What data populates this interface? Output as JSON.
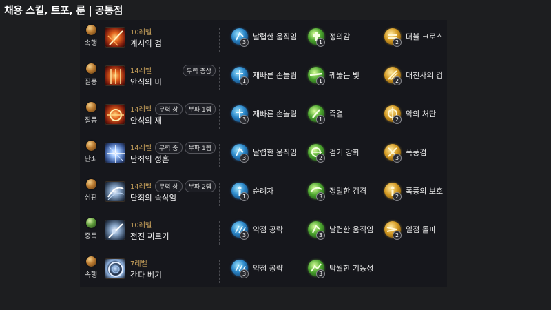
{
  "page_title": "채용 스킬, 트포, 룬 | 공통점",
  "colors": {
    "background": "#1d1e20",
    "panel": "#16171c",
    "level_text": "#c9a25b",
    "tripod_blue": "#2a86c8",
    "tripod_green": "#4ba52e",
    "tripod_gold": "#d49a22"
  },
  "rows": [
    {
      "rune": {
        "name": "속행",
        "icon": "rune-gem-icon"
      },
      "skill": {
        "level": "10레벨",
        "name": "계시의 검",
        "icon": "sword-revelation-icon"
      },
      "tags": [],
      "tripods": [
        {
          "name": "날렵한 움직임",
          "level": "3",
          "icon": "agile-movement-icon"
        },
        {
          "name": "정의감",
          "level": "1",
          "icon": "justice-icon"
        },
        {
          "name": "더블 크로스",
          "level": "2",
          "icon": "double-cross-icon"
        }
      ]
    },
    {
      "rune": {
        "name": "질풍",
        "icon": "rune-gem-icon"
      },
      "skill": {
        "level": "14레벨",
        "name": "안식의 비",
        "icon": "rain-of-rest-icon"
      },
      "tags": [
        "무력 증상"
      ],
      "tripods": [
        {
          "name": "재빠른 손놀림",
          "level": "1",
          "icon": "quick-hands-icon"
        },
        {
          "name": "꿰뚫는 빛",
          "level": "1",
          "icon": "piercing-light-icon"
        },
        {
          "name": "대천사의 검",
          "level": "2",
          "icon": "archangel-sword-icon"
        }
      ]
    },
    {
      "rune": {
        "name": "질풍",
        "icon": "rune-gem-icon"
      },
      "skill": {
        "level": "14레벨",
        "name": "안식의 재",
        "icon": "ash-of-rest-icon"
      },
      "tags": [
        "무력 상",
        "부파 1렙"
      ],
      "tripods": [
        {
          "name": "재빠른 손놀림",
          "level": "3",
          "icon": "quick-hands-icon"
        },
        {
          "name": "즉결",
          "level": "1",
          "icon": "summary-judgment-icon"
        },
        {
          "name": "악의 처단",
          "level": "2",
          "icon": "evil-punishment-icon"
        }
      ]
    },
    {
      "rune": {
        "name": "단죄",
        "icon": "rune-gem-icon"
      },
      "skill": {
        "level": "14레벨",
        "name": "단죄의 성흔",
        "icon": "stigma-of-judgment-icon"
      },
      "tags": [
        "무력 중",
        "부파 1렙"
      ],
      "tripods": [
        {
          "name": "날렵한 움직임",
          "level": "3",
          "icon": "agile-movement-icon"
        },
        {
          "name": "검기 강화",
          "level": "2",
          "icon": "sword-energy-icon"
        },
        {
          "name": "폭풍검",
          "level": "3",
          "icon": "storm-sword-icon"
        }
      ]
    },
    {
      "rune": {
        "name": "심판",
        "icon": "rune-gem-icon"
      },
      "skill": {
        "level": "14레벨",
        "name": "단죄의 속삭임",
        "icon": "whisper-of-judgment-icon"
      },
      "tags": [
        "무력 상",
        "부파 2렙"
      ],
      "tripods": [
        {
          "name": "순례자",
          "level": "1",
          "icon": "pilgrim-icon"
        },
        {
          "name": "정밀한 검격",
          "level": "3",
          "icon": "precise-strike-icon"
        },
        {
          "name": "폭풍의 보호",
          "level": "2",
          "icon": "storm-protection-icon"
        }
      ]
    },
    {
      "rune": {
        "name": "중독",
        "icon": "rune-gem-green-icon"
      },
      "skill": {
        "level": "10레벨",
        "name": "전진 찌르기",
        "icon": "forward-thrust-icon"
      },
      "tags": [],
      "tripods": [
        {
          "name": "약점 공략",
          "level": "3",
          "icon": "weak-point-icon"
        },
        {
          "name": "날렵한 움직임",
          "level": "3",
          "icon": "agile-movement-icon"
        },
        {
          "name": "일점 돌파",
          "level": "2",
          "icon": "single-point-breakthrough-icon"
        }
      ]
    },
    {
      "rune": {
        "name": "속행",
        "icon": "rune-gem-icon"
      },
      "skill": {
        "level": "7레벨",
        "name": "간파 베기",
        "icon": "insight-slash-icon"
      },
      "tags": [],
      "tripods": [
        {
          "name": "약점 공략",
          "level": "3",
          "icon": "weak-point-icon"
        },
        {
          "name": "탁월한 기동성",
          "level": "3",
          "icon": "excellent-mobility-icon"
        }
      ]
    }
  ]
}
